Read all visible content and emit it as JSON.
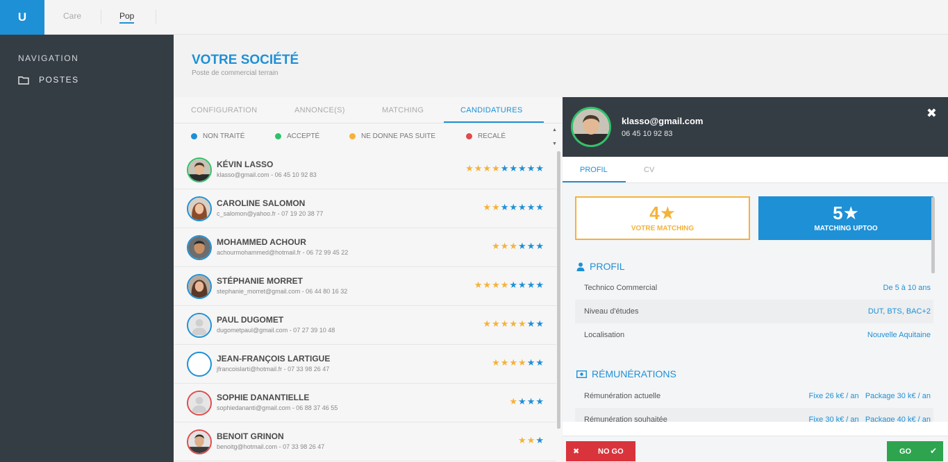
{
  "app": {
    "logo": "U"
  },
  "topnav": {
    "tabs": [
      "Care",
      "Pop"
    ],
    "active": "Pop"
  },
  "sidebar": {
    "title": "NAVIGATION",
    "items": [
      {
        "label": "POSTES",
        "icon": "folder-icon"
      }
    ]
  },
  "header": {
    "title": "VOTRE SOCIÉTÉ",
    "subtitle": "Poste de commercial terrain"
  },
  "tabs": [
    "CONFIGURATION",
    "ANNONCE(S)",
    "MATCHING",
    "CANDIDATURES"
  ],
  "active_tab": "CANDIDATURES",
  "legend": [
    {
      "label": "NON TRAITÉ",
      "color": "#1e90d6"
    },
    {
      "label": "ACCEPTÉ",
      "color": "#2fc26a"
    },
    {
      "label": "NE DONNE PAS SUITE",
      "color": "#f5b23a"
    },
    {
      "label": "RECALÉ",
      "color": "#e04a4a"
    }
  ],
  "candidates": [
    {
      "name": "KÉVIN LASSO",
      "contact": "klasso@gmail.com - 06 45 10 92 83",
      "status": "green",
      "yellow": 4,
      "blue": 5,
      "photo": "man1"
    },
    {
      "name": "CAROLINE SALOMON",
      "contact": "c_salomon@yahoo.fr - 07 19 20 38 77",
      "status": "blue",
      "yellow": 2,
      "blue": 5,
      "photo": "woman1"
    },
    {
      "name": "MOHAMMED ACHOUR",
      "contact": "achourmohammed@hotmail.fr - 06 72 99 45 22",
      "status": "blue",
      "yellow": 3,
      "blue": 3,
      "photo": "man2"
    },
    {
      "name": "STÉPHANIE MORRET",
      "contact": "stephanie_morret@gmail.com - 06 44 80 16 32",
      "status": "blue",
      "yellow": 4,
      "blue": 4,
      "photo": "woman2"
    },
    {
      "name": "PAUL DUGOMET",
      "contact": "dugometpaul@gmail.com - 07 27 39 10 48",
      "status": "blue",
      "yellow": 5,
      "blue": 2,
      "photo": "placeholder"
    },
    {
      "name": "JEAN-FRANÇOIS LARTIGUE",
      "contact": "jfrancoislarti@hotmail.fr - 07 33 98 26 47",
      "status": "blue",
      "yellow": 4,
      "blue": 2,
      "photo": "none"
    },
    {
      "name": "SOPHIE DANANTIELLE",
      "contact": "sophiedananti@gmail.com - 06 88 37 46 55",
      "status": "red",
      "yellow": 1,
      "blue": 3,
      "photo": "placeholder"
    },
    {
      "name": "BENOIT GRINON",
      "contact": "benoitg@hotmail.com - 07 33 98 26 47",
      "status": "red",
      "yellow": 2,
      "blue": 1,
      "photo": "man3"
    }
  ],
  "detail": {
    "email": "klasso@gmail.com",
    "phone": "06 45 10 92 83",
    "tabs": [
      "PROFIL",
      "CV"
    ],
    "active_tab": "PROFIL",
    "my_matching": {
      "value": "4",
      "label": "VOTRE MATCHING"
    },
    "uptoo_matching": {
      "value": "5",
      "label": "MATCHING UPTOO"
    },
    "profil_title": "PROFIL",
    "profil_rows": [
      {
        "key": "Technico Commercial",
        "value": "De 5 à 10 ans"
      },
      {
        "key": "Niveau d'études",
        "value": "DUT, BTS, BAC+2"
      },
      {
        "key": "Localisation",
        "value": "Nouvelle Aquitaine"
      }
    ],
    "remu_title": "RÉMUNÉRATIONS",
    "remu_rows": [
      {
        "key": "Rémunération actuelle",
        "value": "Fixe 26 k€ / an   Package 30 k€ / an"
      },
      {
        "key": "Rémunération souhaitée",
        "value": "Fixe 30 k€ / an   Package 40 k€ / an"
      }
    ],
    "nogo_label": "NO GO",
    "go_label": "GO"
  }
}
